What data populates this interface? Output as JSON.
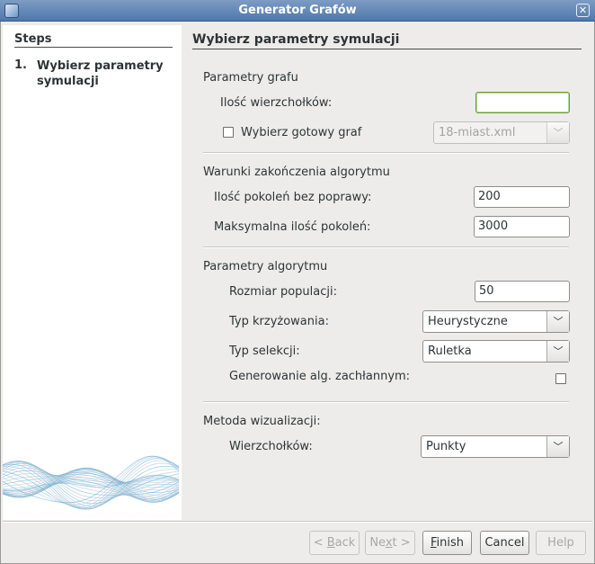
{
  "window": {
    "title": "Generator Grafów",
    "close_glyph": "✕"
  },
  "sidebar": {
    "title": "Steps",
    "steps": [
      {
        "number": "1.",
        "label": "Wybierz parametry symulacji"
      }
    ]
  },
  "main": {
    "title": "Wybierz parametry symulacji",
    "graph_params": {
      "header": "Parametry grafu",
      "vertex_count_label": "Ilość wierzchołków:",
      "vertex_count_value": "",
      "ready_graph_label": "Wybierz gotowy graf",
      "ready_graph_checked": false,
      "ready_graph_select": "18-miast.xml"
    },
    "stop_conditions": {
      "header": "Warunki zakończenia algorytmu",
      "gens_no_improvement_label": "Ilość pokoleń bez poprawy:",
      "gens_no_improvement_value": "200",
      "max_gens_label": "Maksymalna ilość pokoleń:",
      "max_gens_value": "3000"
    },
    "algorithm_params": {
      "header": "Parametry algorytmu",
      "population_label": "Rozmiar populacji:",
      "population_value": "50",
      "crossover_label": "Typ krzyżowania:",
      "crossover_value": "Heurystyczne",
      "selection_label": "Typ selekcji:",
      "selection_value": "Ruletka",
      "greedy_label": "Generowanie alg. zachłannym:",
      "greedy_checked": false
    },
    "visualization": {
      "header": "Metoda wizualizacji:",
      "vertices_label": "Wierzchołków:",
      "vertices_value": "Punkty"
    }
  },
  "footer": {
    "back_pre": "< ",
    "back_key": "B",
    "back_post": "ack",
    "next_pre": "Ne",
    "next_key": "x",
    "next_post": "t >",
    "finish_key": "F",
    "finish_post": "inish",
    "cancel": "Cancel",
    "help": "Help"
  },
  "icons": {
    "dropdown": "chevron-down-icon",
    "close": "close-icon",
    "app": "cube-icon"
  },
  "colors": {
    "titlebar": "#5077ad",
    "focus_border": "#6b9a3a",
    "wave": "#4fa9d3"
  }
}
